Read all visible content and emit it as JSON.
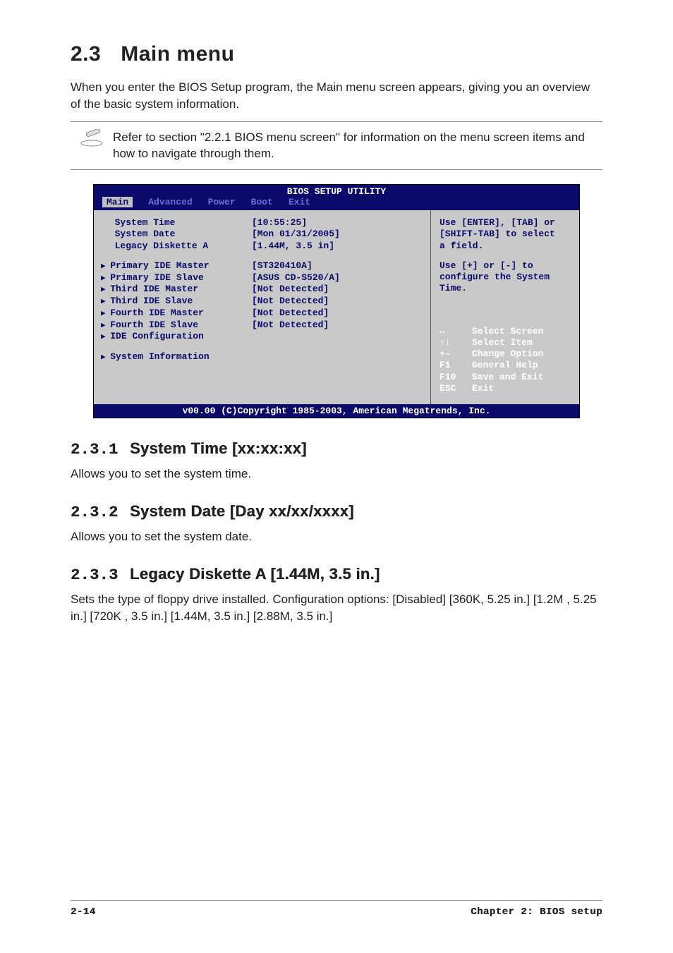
{
  "header": {
    "title_num": "2.3",
    "title_text": "Main menu"
  },
  "intro": "When you enter the BIOS Setup program, the Main menu screen appears, giving you an overview of the basic system information.",
  "note": "Refer to section \"2.2.1  BIOS menu screen\" for information on the menu screen items and how to navigate through them.",
  "bios": {
    "title": "BIOS SETUP UTILITY",
    "tabs": [
      "Main",
      "Advanced",
      "Power",
      "Boot",
      "Exit"
    ],
    "rows_top": [
      {
        "label": "System Time",
        "value": "[10:55:25]"
      },
      {
        "label": "System Date",
        "value": "[Mon 01/31/2005]"
      },
      {
        "label": "Legacy Diskette A",
        "value": "[1.44M, 3.5 in]"
      }
    ],
    "rows_mid": [
      {
        "label": "Primary IDE Master",
        "value": "[ST320410A]"
      },
      {
        "label": "Primary IDE Slave",
        "value": "[ASUS CD-S520/A]"
      },
      {
        "label": "Third IDE Master",
        "value": "[Not Detected]"
      },
      {
        "label": "Third IDE Slave",
        "value": "[Not Detected]"
      },
      {
        "label": "Fourth IDE Master",
        "value": "[Not Detected]"
      },
      {
        "label": "Fourth IDE Slave",
        "value": "[Not Detected]"
      },
      {
        "label": "IDE Configuration",
        "value": ""
      }
    ],
    "rows_bot": [
      {
        "label": "System Information",
        "value": ""
      }
    ],
    "help1_l1": "Use [ENTER], [TAB] or",
    "help1_l2": "[SHIFT-TAB] to select",
    "help1_l3": "a field.",
    "help2_l1": "Use [+] or [-] to",
    "help2_l2": "configure the System",
    "help2_l3": "Time.",
    "nav": [
      {
        "key": "↔",
        "act": "Select Screen"
      },
      {
        "key": "↑↓",
        "act": "Select Item"
      },
      {
        "key": "+-",
        "act": "Change Option"
      },
      {
        "key": "F1",
        "act": "General Help"
      },
      {
        "key": "F10",
        "act": "Save and Exit"
      },
      {
        "key": "ESC",
        "act": "Exit"
      }
    ],
    "footer": "v00.00 (C)Copyright 1985-2003, American Megatrends, Inc."
  },
  "sections": [
    {
      "num": "2.3.1",
      "title": "System Time [xx:xx:xx]",
      "body": "Allows you to set the system time."
    },
    {
      "num": "2.3.2",
      "title": "System Date [Day xx/xx/xxxx]",
      "body": "Allows you to set the system date."
    },
    {
      "num": "2.3.3",
      "title": "Legacy Diskette A [1.44M, 3.5 in.]",
      "body": "Sets the type of floppy drive installed. Configuration options: [Disabled] [360K, 5.25 in.] [1.2M , 5.25 in.] [720K , 3.5 in.] [1.44M, 3.5 in.] [2.88M, 3.5 in.]"
    }
  ],
  "footer": {
    "left": "2-14",
    "right": "Chapter 2: BIOS setup"
  }
}
